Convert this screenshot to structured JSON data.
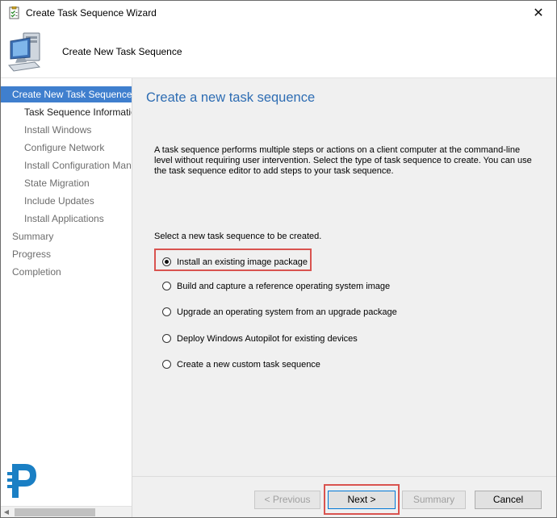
{
  "window": {
    "title": "Create Task Sequence Wizard",
    "close_glyph": "✕"
  },
  "header": {
    "title": "Create New Task Sequence"
  },
  "sidebar": {
    "items": [
      {
        "label": "Create New Task Sequence"
      },
      {
        "label": "Task Sequence Information"
      },
      {
        "label": "Install Windows"
      },
      {
        "label": "Configure Network"
      },
      {
        "label": "Install Configuration Manager"
      },
      {
        "label": "State Migration"
      },
      {
        "label": "Include Updates"
      },
      {
        "label": "Install Applications"
      },
      {
        "label": "Summary"
      },
      {
        "label": "Progress"
      },
      {
        "label": "Completion"
      }
    ],
    "scroll_arrow": "◀"
  },
  "main": {
    "title": "Create a new task sequence",
    "description": "A task sequence performs multiple steps or actions on a client computer at the command-line level without requiring user intervention. Select the type of task sequence to create. You can use the task sequence editor to add steps to your task sequence.",
    "prompt": "Select a new task sequence to be created.",
    "options": [
      {
        "label": "Install an existing image package",
        "selected": true
      },
      {
        "label": "Build and capture a reference operating system image",
        "selected": false
      },
      {
        "label": "Upgrade an operating system from an upgrade package",
        "selected": false
      },
      {
        "label": "Deploy Windows Autopilot for existing devices",
        "selected": false
      },
      {
        "label": "Create a new custom task sequence",
        "selected": false
      }
    ]
  },
  "buttons": {
    "previous": "< Previous",
    "next": "Next >",
    "summary": "Summary",
    "cancel": "Cancel"
  },
  "colors": {
    "accent": "#3f7fce",
    "title_blue": "#2e6db3",
    "highlight_red": "#d9534f"
  },
  "icons": {
    "title": "task-sequence-icon",
    "header": "computer-icon",
    "brand": "brand-logo-icon"
  }
}
